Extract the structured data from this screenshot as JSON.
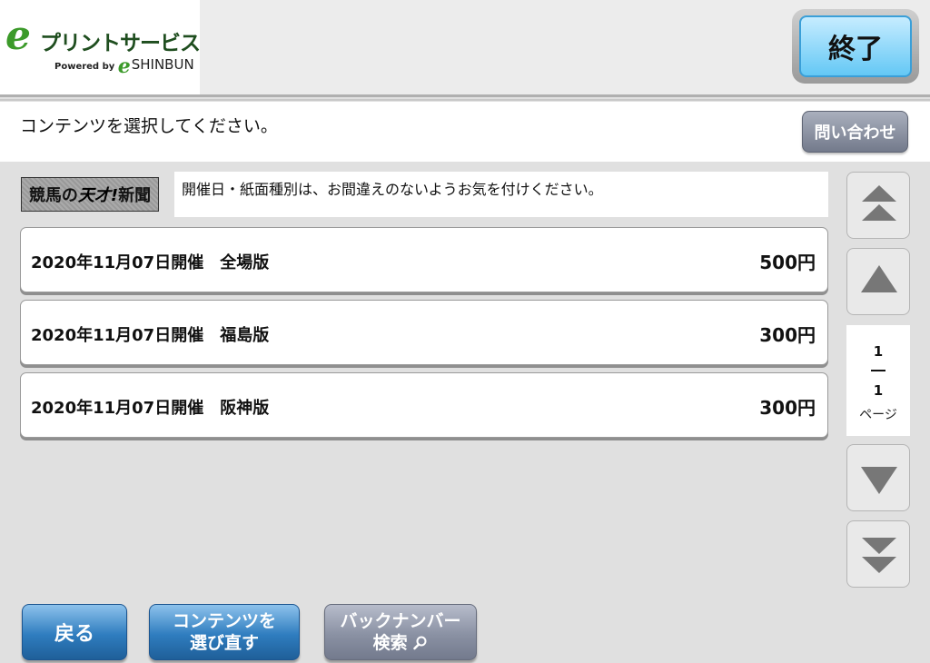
{
  "header": {
    "logo_e": "e",
    "logo_name": "プリントサービス",
    "powered_by": "Powered by",
    "powered_e": "e",
    "powered_name": "SHINBUN",
    "exit_label": "終了"
  },
  "instruction": {
    "text": "コンテンツを選択してください。",
    "inquiry_label": "問い合わせ"
  },
  "newspaper": {
    "logo_part1": "競馬の",
    "logo_part2": "天才!",
    "logo_part3": "新聞",
    "notice": "開催日・紙面種別は、お間違えのないようお気を付けください。"
  },
  "contents": [
    {
      "title": "2020年11月07日開催　全場版",
      "price": "500円"
    },
    {
      "title": "2020年11月07日開催　福島版",
      "price": "300円"
    },
    {
      "title": "2020年11月07日開催　阪神版",
      "price": "300円"
    }
  ],
  "pager": {
    "current": "1",
    "total": "1",
    "label": "ページ"
  },
  "footer": {
    "back_label": "戻る",
    "reselect_line1": "コンテンツを",
    "reselect_line2": "選び直す",
    "backnumber_line1": "バックナンバー",
    "backnumber_line2": "検索"
  },
  "icons": {
    "scroll_top": "double-up-triangle",
    "scroll_up": "up-triangle",
    "scroll_down": "down-triangle",
    "scroll_bottom": "double-down-triangle",
    "search": "magnifier"
  },
  "colors": {
    "exit_button": "#64c8f5",
    "primary_button": "#2f7dbf",
    "secondary_button": "#8a91a3",
    "logo_green": "#3c9a2a"
  }
}
